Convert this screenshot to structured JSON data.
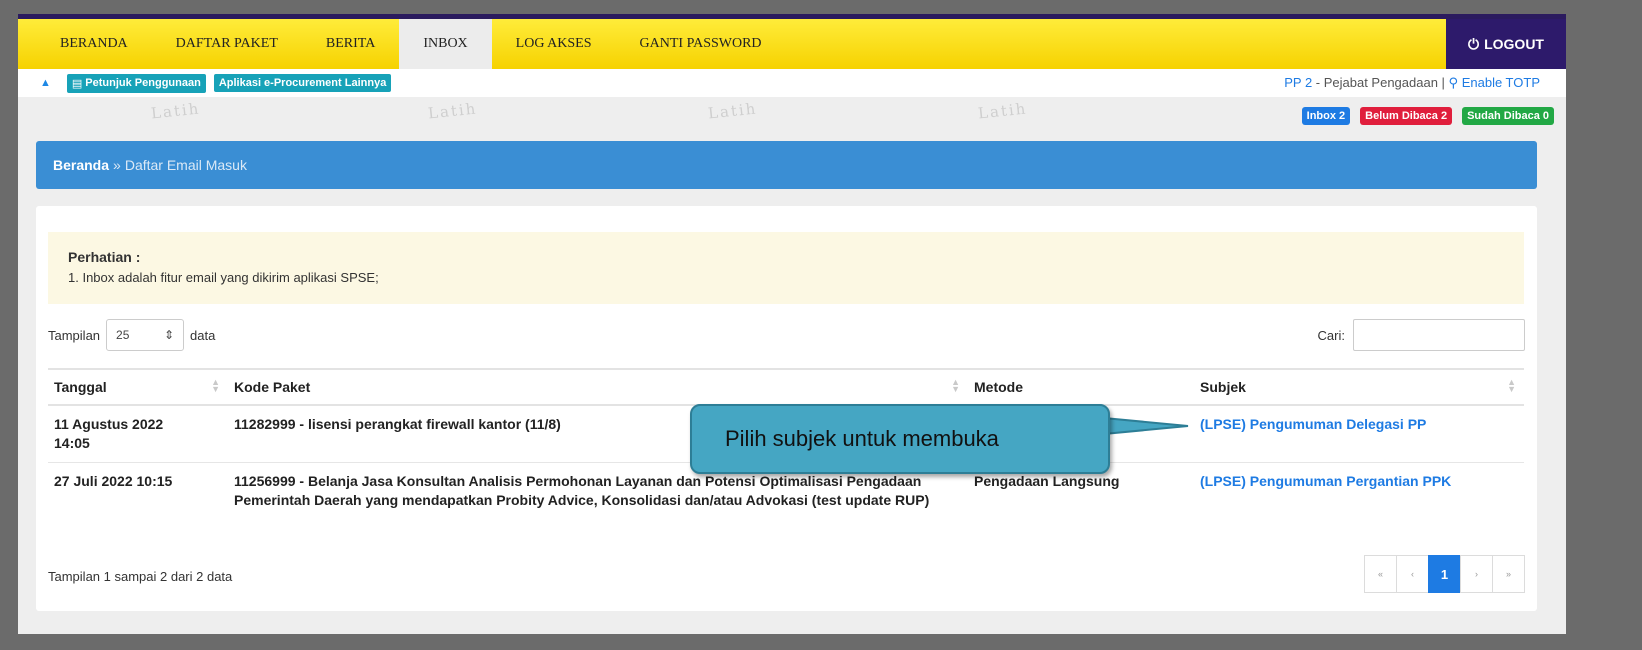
{
  "nav": {
    "items": [
      "BERANDA",
      "DAFTAR PAKET",
      "BERITA",
      "INBOX",
      "LOG AKSES",
      "GANTI PASSWORD"
    ],
    "active_index": 3,
    "logout": "LOGOUT"
  },
  "subbar": {
    "guide": "Petunjuk Penggunaan",
    "other_apps": "Aplikasi e-Procurement Lainnya",
    "user_role": "PP 2",
    "user_title": " - Pejabat Pengadaan | ",
    "totp": "Enable TOTP"
  },
  "watermark": "Latih",
  "badges": {
    "inbox": "Inbox 2",
    "unread": "Belum Dibaca 2",
    "read": "Sudah Dibaca 0"
  },
  "breadcrumb": {
    "home": "Beranda",
    "separator": "»",
    "current": "Daftar Email Masuk"
  },
  "notice": {
    "title": "Perhatian :",
    "line1": "1. Inbox adalah fitur email yang dikirim aplikasi SPSE;"
  },
  "table_controls": {
    "show_prefix": "Tampilan",
    "page_size": "25",
    "show_suffix": "data",
    "search_label": "Cari:"
  },
  "table": {
    "headers": [
      "Tanggal",
      "Kode Paket",
      "Metode",
      "Subjek"
    ],
    "rows": [
      {
        "tanggal": "11 Agustus 2022 14:05",
        "kode": "11282999 - lisensi perangkat firewall kantor (11/8)",
        "metode": "",
        "subjek": "(LPSE) Pengumuman Delegasi PP"
      },
      {
        "tanggal": "27 Juli 2022 10:15",
        "kode": "11256999 - Belanja Jasa Konsultan Analisis Permohonan Layanan dan Potensi Optimalisasi Pengadaan Pemerintah Daerah yang mendapatkan Probity Advice, Konsolidasi dan/atau Advokasi (test update RUP)",
        "metode": "Pengadaan Langsung",
        "subjek": "(LPSE) Pengumuman Pergantian PPK"
      }
    ]
  },
  "footer": {
    "info": "Tampilan 1 sampai 2 dari 2 data",
    "pages": [
      "«",
      "‹",
      "1",
      "›",
      "»"
    ],
    "current_page": "1"
  },
  "callout": {
    "text": "Pilih subjek untuk membuka"
  },
  "colors": {
    "nav_bg": "#f6d200",
    "logout_bg": "#2d1a6b",
    "breadcrumb_bg": "#3a8ed4",
    "link": "#1e7be3",
    "callout_bg": "#45a6c3"
  }
}
